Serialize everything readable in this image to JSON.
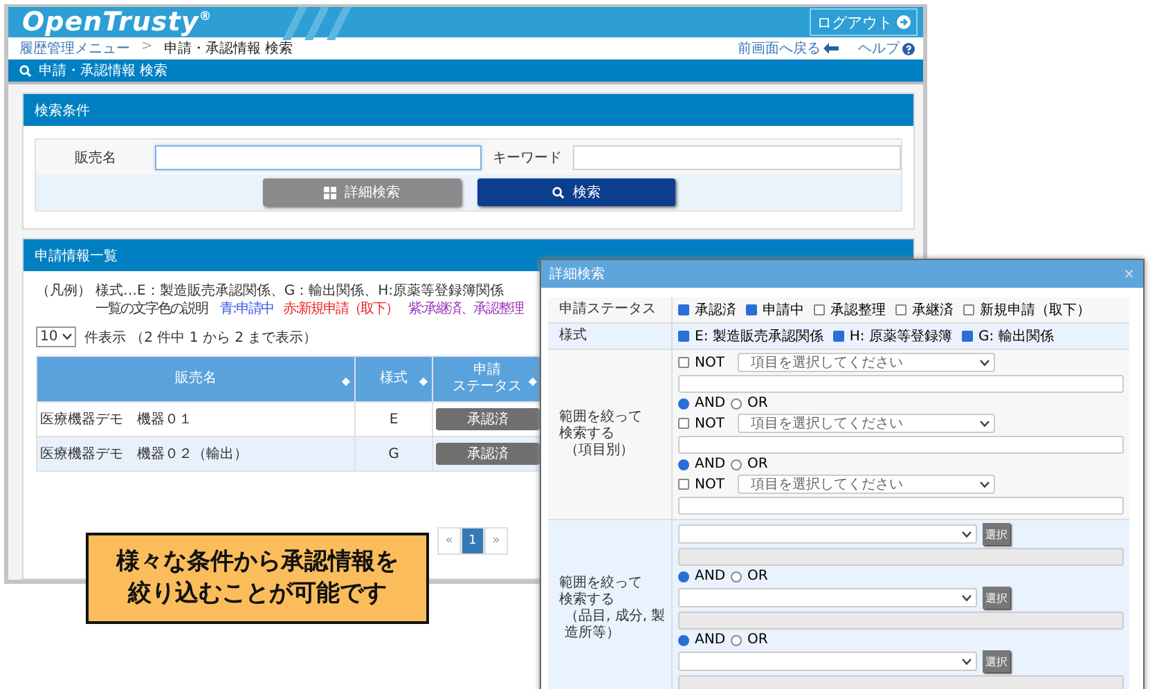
{
  "header": {
    "logo": "OpenTrusty",
    "logo_mark": "®",
    "logout": "ログアウト"
  },
  "breadcrumb": {
    "items": [
      "履歴管理メニュー",
      "申請・承認情報 検索"
    ],
    "separator": ">"
  },
  "nav_links": [
    {
      "label": "前画面へ戻る",
      "kind": "back"
    },
    {
      "label": "ヘルプ",
      "kind": "help"
    }
  ],
  "page_title": "申請・承認情報 検索",
  "search_panel": {
    "title": "検索条件",
    "fields": [
      {
        "label": "販売名",
        "focused": true
      },
      {
        "label": "キーワード",
        "focused": false
      }
    ],
    "buttons": [
      {
        "label": "詳細検索",
        "kind": "secondary"
      },
      {
        "label": "検索",
        "kind": "primary"
      }
    ]
  },
  "list_panel": {
    "title": "申請情報一覧",
    "legend_mark": "（凡例）",
    "legend_forms": "様式…E：製造販売承認関係、G：輸出関係、H:原薬等登録簿関係",
    "legend_colors_label": "一覧の文字色の説明",
    "legend_colors": [
      {
        "label": "青:申請中",
        "color": "#3355ee"
      },
      {
        "label": "赤:新規申請（取下）",
        "color": "#ee2222"
      },
      {
        "label": "紫:承継済、承認整理",
        "color": "#9933bb"
      }
    ],
    "page_size": "10",
    "page_info": "件表示 （2 件中 1 から 2 まで表示）",
    "columns": [
      {
        "lines": [
          "販売名"
        ],
        "sort_mark": "◆"
      },
      {
        "lines": [
          "様式"
        ],
        "sort_mark": "◆"
      },
      {
        "lines": [
          "申請",
          "ステータス"
        ],
        "sort_mark": "◆"
      }
    ],
    "rows": [
      {
        "name": "医療機器デモ　機器０１",
        "form": "E",
        "status": "承認済"
      },
      {
        "name": "医療機器デモ　機器０２（輸出）",
        "form": "G",
        "status": "承認済"
      }
    ],
    "pagination": {
      "prev": "«",
      "pages": [
        {
          "label": "1",
          "selected": true
        }
      ],
      "next": "»"
    }
  },
  "dialog": {
    "title": "詳細検索",
    "close": "×",
    "status": {
      "label": "申請ステータス",
      "options": [
        {
          "label": "承認済",
          "checked": true
        },
        {
          "label": "申請中",
          "checked": true
        },
        {
          "label": "承認整理",
          "checked": false
        },
        {
          "label": "承継済",
          "checked": false
        },
        {
          "label": "新規申請（取下）",
          "checked": false
        }
      ]
    },
    "forms": {
      "label": "様式",
      "options": [
        {
          "label": "E: 製造販売承認関係",
          "checked": true
        },
        {
          "label": "H: 原薬等登録簿",
          "checked": true
        },
        {
          "label": "G: 輸出関係",
          "checked": true
        }
      ]
    },
    "sections": [
      {
        "label": [
          "範囲を絞って",
          "検索する",
          "（項目別）"
        ],
        "items": [
          {
            "kind": "condition",
            "not": "NOT",
            "not_checked": false,
            "placeholder": "項目を選択してください"
          },
          {
            "kind": "join",
            "and": "AND",
            "or": "OR",
            "and_selected": true
          },
          {
            "kind": "condition",
            "not": "NOT",
            "not_checked": false,
            "placeholder": "項目を選択してください"
          },
          {
            "kind": "join",
            "and": "AND",
            "or": "OR",
            "and_selected": true
          },
          {
            "kind": "condition",
            "not": "NOT",
            "not_checked": false,
            "placeholder": "項目を選択してください"
          }
        ]
      },
      {
        "label": [
          "範囲を絞って",
          "検索する",
          "（品目, 成分, 製造所等）"
        ],
        "items": [
          {
            "kind": "picker",
            "button": "選択"
          },
          {
            "kind": "join",
            "and": "AND",
            "or": "OR",
            "and_selected": true
          },
          {
            "kind": "picker",
            "button": "選択"
          },
          {
            "kind": "join",
            "and": "AND",
            "or": "OR",
            "and_selected": true
          },
          {
            "kind": "picker",
            "button": "選択"
          }
        ]
      }
    ]
  },
  "callout": [
    "様々な条件から承認情報を",
    "絞り込むことが可能です"
  ]
}
